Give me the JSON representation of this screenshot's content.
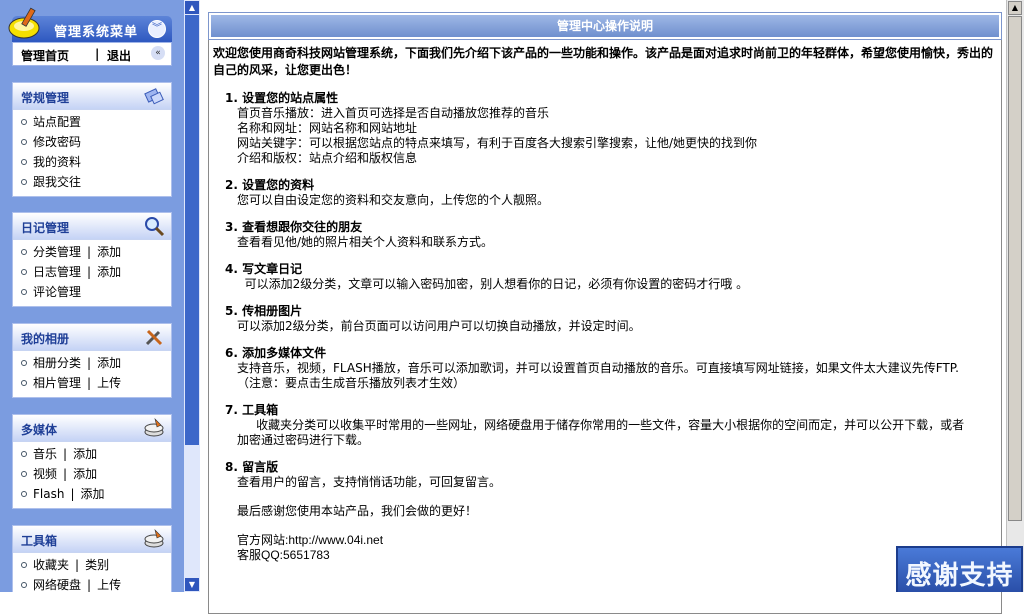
{
  "sidebar": {
    "title": "管理系统菜单",
    "nav": {
      "home": "管理首页",
      "sep": "|",
      "logout": "退出"
    },
    "groups": [
      {
        "title": "常规管理",
        "icon": "network-icon",
        "items": [
          [
            "站点配置"
          ],
          [
            "修改密码"
          ],
          [
            "我的资料"
          ],
          [
            "跟我交往"
          ]
        ]
      },
      {
        "title": "日记管理",
        "icon": "magnifier-icon",
        "items": [
          [
            "分类管理",
            "添加"
          ],
          [
            "日志管理",
            "添加"
          ],
          [
            "评论管理"
          ]
        ]
      },
      {
        "title": "我的相册",
        "icon": "tools-icon",
        "items": [
          [
            "相册分类",
            "添加"
          ],
          [
            "相片管理",
            "上传"
          ]
        ]
      },
      {
        "title": "多媒体",
        "icon": "stack-icon",
        "items": [
          [
            "音乐",
            "添加"
          ],
          [
            "视频",
            "添加"
          ],
          [
            "Flash",
            "添加"
          ]
        ]
      },
      {
        "title": "工具箱",
        "icon": "stack-icon",
        "items": [
          [
            "收藏夹",
            "类别"
          ],
          [
            "网络硬盘",
            "上传"
          ]
        ]
      }
    ]
  },
  "main": {
    "title": "管理中心操作说明",
    "intro": "欢迎您使用商奇科技网站管理系统，下面我们先介绍下该产品的一些功能和操作。该产品是面对追求时尚前卫的年轻群体，希望您使用愉快，秀出的自己的风采，让您更出色！",
    "sections": [
      {
        "h": "1. 设置您的站点属性",
        "lines": [
          "首页音乐播放：进入首页可选择是否自动播放您推荐的音乐",
          "名称和网址：网站名称和网站地址",
          "网站关键字：可以根据您站点的特点来填写，有利于百度各大搜索引擎搜索，让他/她更快的找到你",
          "介绍和版权：站点介绍和版权信息"
        ]
      },
      {
        "h": "2. 设置您的资料",
        "lines": [
          "您可以自由设定您的资料和交友意向，上传您的个人靓照。"
        ]
      },
      {
        "h": "3. 查看想跟你交往的朋友",
        "lines": [
          "查看看见他/她的照片相关个人资料和联系方式。"
        ]
      },
      {
        "h": "4. 写文章日记",
        "lines": [
          "  可以添加2级分类，文章可以输入密码加密，别人想看你的日记，必须有你设置的密码才行哦 。"
        ]
      },
      {
        "h": "5. 传相册图片",
        "lines": [
          "可以添加2级分类，前台页面可以访问用户可以切换自动播放，并设定时间。"
        ]
      },
      {
        "h": "6. 添加多媒体文件",
        "lines": [
          "支持音乐，视频，FLASH播放，音乐可以添加歌词，并可以设置首页自动播放的音乐。可直接填写网址链接，如果文件太大建议先传FTP.",
          "（注意：要点击生成音乐播放列表才生效）"
        ]
      },
      {
        "h": "7. 工具箱",
        "lines": [
          "     收藏夹分类可以收集平时常用的一些网址，网络硬盘用于储存你常用的一些文件，容量大小根据你的空间而定，并可以公开下载，或者",
          "加密通过密码进行下载。"
        ]
      },
      {
        "h": "8. 留言版",
        "lines": [
          "查看用户的留言，支持悄悄话功能，可回复留言。"
        ]
      }
    ],
    "thanks_note": "最后感谢您使用本站产品，我们会做的更好！",
    "website": "官方网站:http://www.04i.net",
    "qq": "客服QQ:5651783"
  },
  "float_button": "感谢支持",
  "colors": {
    "sidebar_bg": "#7b9ce0",
    "header_blue": "#2e58c0",
    "group_title": "#1f3f97"
  }
}
